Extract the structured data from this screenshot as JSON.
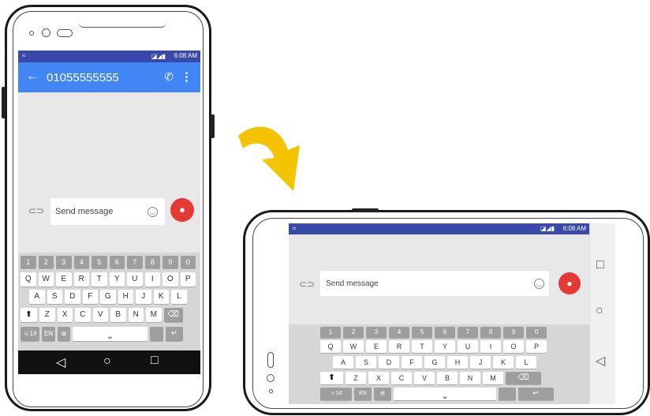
{
  "status_bar": {
    "time": "6:08 AM"
  },
  "conversation": {
    "title": "01055555555",
    "compose_placeholder": "Send message"
  },
  "keyboard": {
    "number_row": [
      "1",
      "2",
      "3",
      "4",
      "5",
      "6",
      "7",
      "8",
      "9",
      "0"
    ],
    "row1": [
      "Q",
      "W",
      "E",
      "R",
      "T",
      "Y",
      "U",
      "I",
      "O",
      "P"
    ],
    "row2": [
      "A",
      "S",
      "D",
      "F",
      "G",
      "H",
      "J",
      "K",
      "L"
    ],
    "row3": [
      "Z",
      "X",
      "C",
      "V",
      "B",
      "N",
      "M"
    ],
    "symbols_key": "☺1#",
    "language_key": "EN"
  },
  "icons": {
    "back": "arrow-left-icon",
    "call": "phone-icon",
    "more": "more-vert-icon",
    "attach": "paperclip-icon",
    "emoji": "emoji-icon",
    "contact": "person-icon",
    "nav_back": "triangle-back-icon",
    "nav_home": "circle-home-icon",
    "nav_recents": "square-recents-icon",
    "rotate_arrow": "curved-arrow-icon"
  },
  "colors": {
    "app_bar": "#4285f4",
    "status_bar": "#3949ab",
    "fab": "#e53935",
    "arrow": "#f5c400"
  }
}
